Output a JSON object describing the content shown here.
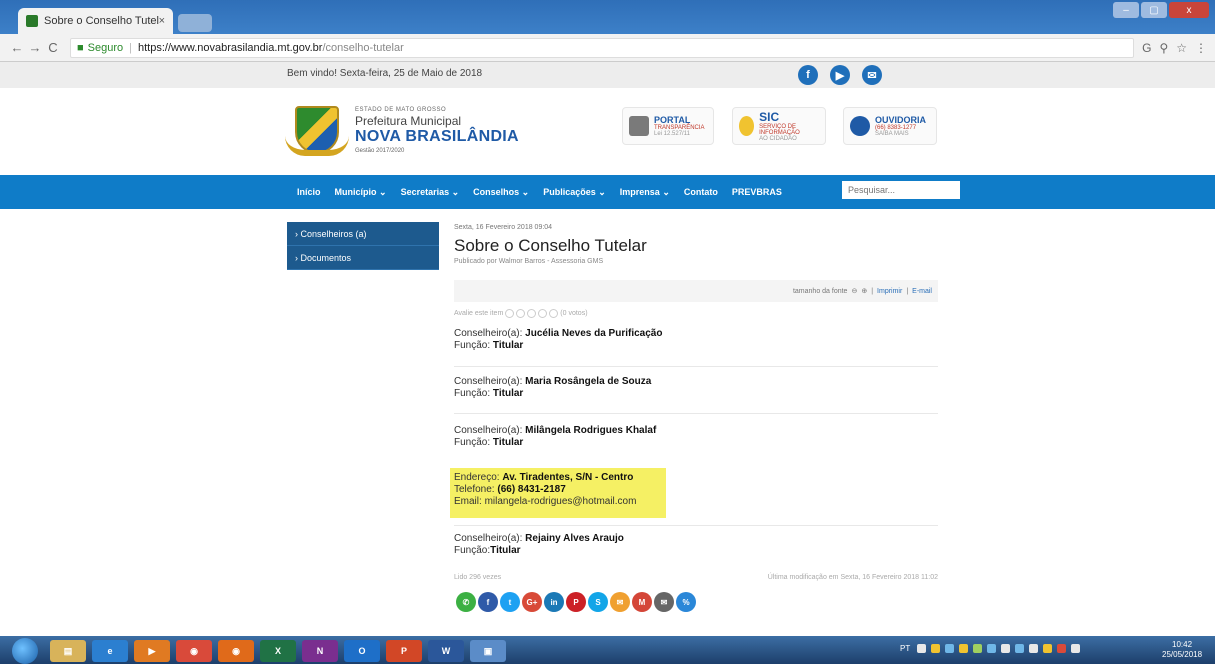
{
  "browser": {
    "tab_title": "Sobre o Conselho Tutelar",
    "tab_close": "×",
    "nav_back": "←",
    "nav_forward": "→",
    "nav_reload": "C",
    "secure_label": "Seguro",
    "url_host": "https://www.novabrasilandia.mt.gov.br",
    "url_path": "/conselho-tutelar",
    "toolbar_icons": [
      "G",
      "⚲",
      "☆",
      "⋮"
    ],
    "window_buttons": [
      "–",
      "▢",
      "x"
    ]
  },
  "topbar": {
    "welcome": "Bem vindo! Sexta-feira, 25 de Maio de 2018",
    "social": [
      {
        "icon": "facebook-icon",
        "glyph": "f",
        "color": "#1f6fba"
      },
      {
        "icon": "youtube-icon",
        "glyph": "▶",
        "color": "#1f6fba"
      },
      {
        "icon": "email-icon",
        "glyph": "✉",
        "color": "#1f6fba"
      }
    ]
  },
  "header": {
    "state": "ESTADO DE MATO GROSSO",
    "prefeitura": "Prefeitura Municipal",
    "city": "NOVA BRASILÂNDIA",
    "gestao": "Gestão 2017/2020",
    "badges": [
      {
        "title": "PORTAL",
        "sub": "TRANSPARÊNCIA",
        "foot": "Lei 12.527/11",
        "color": "#7a7a7a"
      },
      {
        "title": "SIC",
        "sub": "SERVIÇO DE INFORMAÇÃO",
        "foot": "AO CIDADÃO",
        "color": "#f0c330"
      },
      {
        "title": "OUVIDORIA",
        "sub": "(66) 8383-1277",
        "foot": "SAIBA MAIS",
        "color": "#1f5aa6"
      }
    ]
  },
  "nav": {
    "items": [
      "Início",
      "Município ⌄",
      "Secretarias ⌄",
      "Conselhos ⌄",
      "Publicações ⌄",
      "Imprensa ⌄",
      "Contato",
      "PREVBRAS"
    ],
    "search_placeholder": "Pesquisar..."
  },
  "sidebar": {
    "items": [
      "› Conselheiros (a)",
      "› Documentos"
    ]
  },
  "article": {
    "date": "Sexta, 16 Fevereiro 2018 09:04",
    "title": "Sobre o Conselho Tutelar",
    "byline": "Publicado por Walmor Barros - Assessoria GMS",
    "tools": {
      "font_size": "tamanho da fonte",
      "zoom_out": "⊖",
      "zoom_in": "⊕",
      "print": "Imprimir",
      "email": "E-mail",
      "bar": "|"
    },
    "rating_label": "Avalie este item",
    "rating_votes": "(0 votos)",
    "entries": [
      {
        "prefix": "Conselheiro(a): ",
        "name": "Jucélia Neves da Purificação",
        "func_prefix": "Função: ",
        "func": "Titular"
      },
      {
        "prefix": "Conselheiro(a): ",
        "name": "Maria Rosângela de Souza",
        "func_prefix": "Função: ",
        "func": "Titular"
      },
      {
        "prefix": "Conselheiro(a): ",
        "name": "Milângela Rodrigues Khalaf",
        "func_prefix": "Função: ",
        "func": "Titular"
      },
      {
        "prefix": "Conselheiro(a): ",
        "name": "Rejainy Alves Araujo",
        "func_prefix": "Função:",
        "func": "Titular"
      }
    ],
    "contact": {
      "addr_prefix": "Endereço: ",
      "addr": "Av. Tiradentes, S/N - Centro",
      "phone_prefix": "Telefone: ",
      "phone": "(66) 8431-2187",
      "email_prefix": "Email: ",
      "email": "milangela-rodrigues@hotmail.com"
    },
    "reads": "Lido 296 vezes",
    "modified": "Última modificação em Sexta, 16 Fevereiro 2018 11:02"
  },
  "share_buttons": [
    {
      "icon": "whatsapp-icon",
      "glyph": "✆",
      "color": "#3cb043"
    },
    {
      "icon": "facebook-share-icon",
      "glyph": "f",
      "color": "#2f5aa8"
    },
    {
      "icon": "twitter-icon",
      "glyph": "t",
      "color": "#1ea1f2"
    },
    {
      "icon": "google-plus-icon",
      "glyph": "G+",
      "color": "#d84a38"
    },
    {
      "icon": "linkedin-icon",
      "glyph": "in",
      "color": "#1b79b6"
    },
    {
      "icon": "pinterest-icon",
      "glyph": "P",
      "color": "#cc2127"
    },
    {
      "icon": "skype-icon",
      "glyph": "S",
      "color": "#12a5e8"
    },
    {
      "icon": "message-icon",
      "glyph": "✉",
      "color": "#f0a030"
    },
    {
      "icon": "gmail-icon",
      "glyph": "M",
      "color": "#d44638"
    },
    {
      "icon": "email-share-icon",
      "glyph": "✉",
      "color": "#666666"
    },
    {
      "icon": "link-icon",
      "glyph": "%",
      "color": "#2a87d8"
    }
  ],
  "taskbar": {
    "apps": [
      {
        "icon": "explorer-icon",
        "glyph": "▤",
        "color": "#d8b35a"
      },
      {
        "icon": "ie-icon",
        "glyph": "e",
        "color": "#2b7fd0"
      },
      {
        "icon": "media-icon",
        "glyph": "▶",
        "color": "#e07a22"
      },
      {
        "icon": "chrome-icon",
        "glyph": "◉",
        "color": "#d94a3a"
      },
      {
        "icon": "firefox-icon",
        "glyph": "◉",
        "color": "#e06a1a"
      },
      {
        "icon": "excel-icon",
        "glyph": "X",
        "color": "#207245"
      },
      {
        "icon": "onenote-icon",
        "glyph": "N",
        "color": "#7a2e8f"
      },
      {
        "icon": "outlook-icon",
        "glyph": "O",
        "color": "#1e6fc8"
      },
      {
        "icon": "powerpoint-icon",
        "glyph": "P",
        "color": "#d24726"
      },
      {
        "icon": "word-icon",
        "glyph": "W",
        "color": "#2b579a"
      },
      {
        "icon": "window-icon",
        "glyph": "▣",
        "color": "#5b8cc8"
      }
    ],
    "lang": "PT",
    "tray_colors": [
      "#e8e8e8",
      "#f0c330",
      "#6fb7e8",
      "#f0c330",
      "#a0d060",
      "#6fb7e8",
      "#e8e8e8",
      "#6fb7e8",
      "#e8e8e8",
      "#f0c330",
      "#d94a3a",
      "#e8e8e8"
    ],
    "time": "10:42",
    "date": "25/05/2018"
  }
}
